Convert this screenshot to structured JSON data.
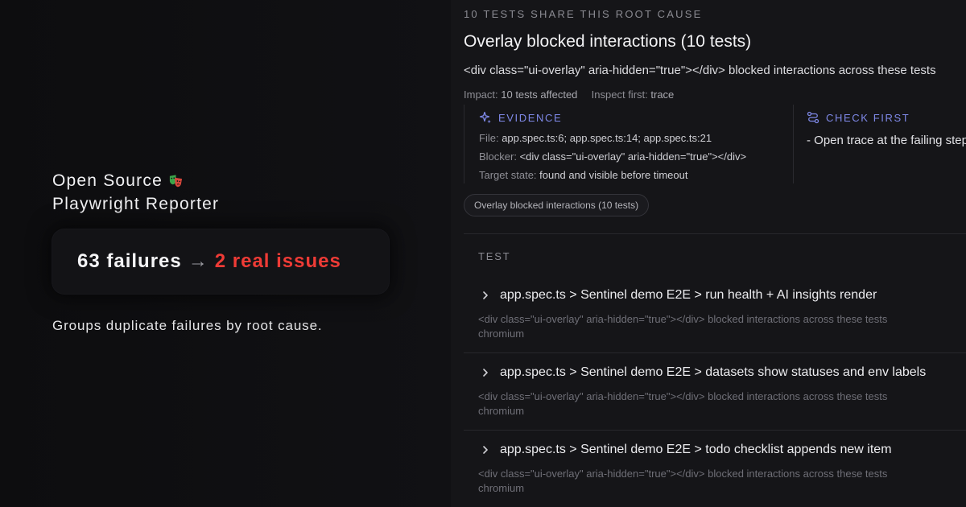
{
  "promo": {
    "brand_line1": "Open Source",
    "brand_line2": "Playwright Reporter",
    "brand_icon": "theater-masks-icon",
    "failures_text": "63 failures",
    "arrow_text": "→",
    "real_issues_text": "2 real issues",
    "tagline": "Groups duplicate failures by root cause."
  },
  "group": {
    "eyebrow": "10 TESTS SHARE THIS ROOT CAUSE",
    "title": "Overlay blocked interactions (10 tests)",
    "description": "<div class=\"ui-overlay\" aria-hidden=\"true\"></div> blocked interactions across these tests",
    "impact_label": "Impact:",
    "impact_value": "10 tests affected",
    "inspect_label": "Inspect first:",
    "inspect_value": "trace",
    "evidence": {
      "heading": "EVIDENCE",
      "icon": "sparkle-icon",
      "file_label": "File:",
      "file_value": "app.spec.ts:6; app.spec.ts:14; app.spec.ts:21",
      "blocker_label": "Blocker:",
      "blocker_value": "<div class=\"ui-overlay\" aria-hidden=\"true\"></div>",
      "target_label": "Target state:",
      "target_value": "found and visible before timeout"
    },
    "check_first": {
      "heading": "CHECK FIRST",
      "icon": "route-icon",
      "item": "- Open trace at the failing step"
    },
    "chip": "Overlay blocked interactions (10 tests)"
  },
  "tests": {
    "column_header": "TEST",
    "rows": [
      {
        "name": "app.spec.ts > Sentinel demo E2E > run health + AI insights render",
        "message": "<div class=\"ui-overlay\" aria-hidden=\"true\"></div> blocked interactions across these tests",
        "project": "chromium"
      },
      {
        "name": "app.spec.ts > Sentinel demo E2E > datasets show statuses and env labels",
        "message": "<div class=\"ui-overlay\" aria-hidden=\"true\"></div> blocked interactions across these tests",
        "project": "chromium"
      },
      {
        "name": "app.spec.ts > Sentinel demo E2E > todo checklist appends new item",
        "message": "<div class=\"ui-overlay\" aria-hidden=\"true\"></div> blocked interactions across these tests",
        "project": "chromium"
      }
    ]
  },
  "colors": {
    "accent": "#7f89e8",
    "danger": "#ef3b36",
    "background": "#0e0e10",
    "panel": "#151518"
  }
}
